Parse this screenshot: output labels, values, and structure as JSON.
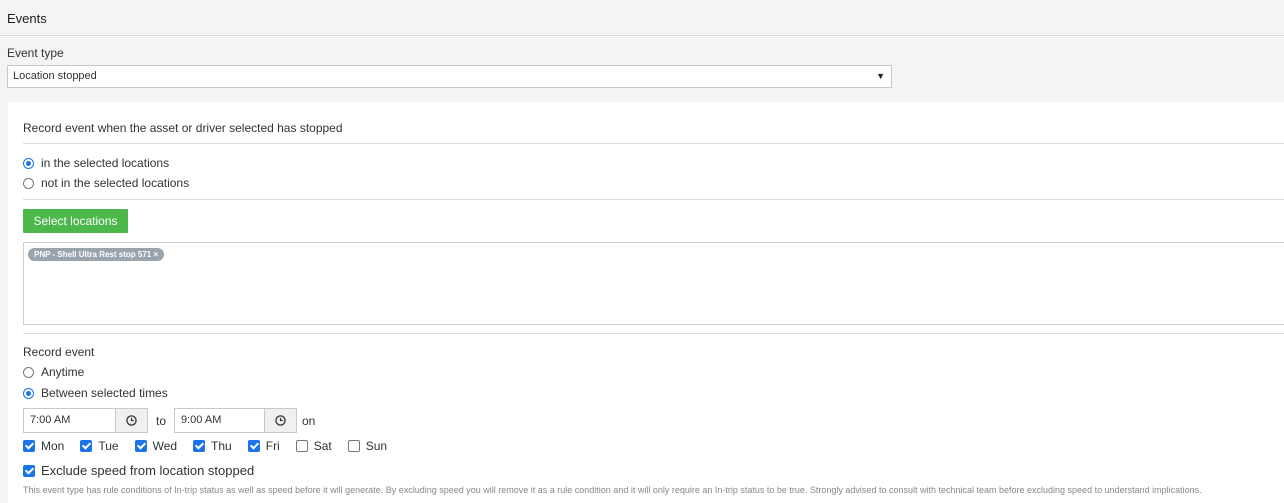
{
  "header": {
    "title": "Events"
  },
  "event_type": {
    "label": "Event type",
    "selected": "Location stopped"
  },
  "rule": {
    "description": "Record event when the asset or driver selected has stopped",
    "location_options": [
      {
        "label": "in the selected locations",
        "selected": true
      },
      {
        "label": "not in the selected locations",
        "selected": false
      }
    ],
    "select_locations_label": "Select locations",
    "selected_locations": [
      "PNP - Shell Ultra Rest stop 571 ×"
    ]
  },
  "record_event": {
    "label": "Record event",
    "options": [
      {
        "label": "Anytime",
        "selected": false
      },
      {
        "label": "Between selected times",
        "selected": true
      }
    ],
    "start_time": "7:00 AM",
    "to_label": "to",
    "end_time": "9:00 AM",
    "on_label": "on",
    "days": [
      {
        "label": "Mon",
        "checked": true
      },
      {
        "label": "Tue",
        "checked": true
      },
      {
        "label": "Wed",
        "checked": true
      },
      {
        "label": "Thu",
        "checked": true
      },
      {
        "label": "Fri",
        "checked": true
      },
      {
        "label": "Sat",
        "checked": false
      },
      {
        "label": "Sun",
        "checked": false
      }
    ]
  },
  "exclude_speed": {
    "label": "Exclude speed from location stopped",
    "checked": true,
    "note": "This event type has rule conditions of In-trip status as well as speed before it will generate. By excluding speed you will remove it as a rule condition and it will only require an In-trip status to be true. Strongly advised to consult with technical team before excluding speed to understand implications."
  },
  "colors": {
    "accent": "#1a73e8",
    "button_green": "#4cb84c",
    "tag_gray": "#9aa4ad"
  }
}
